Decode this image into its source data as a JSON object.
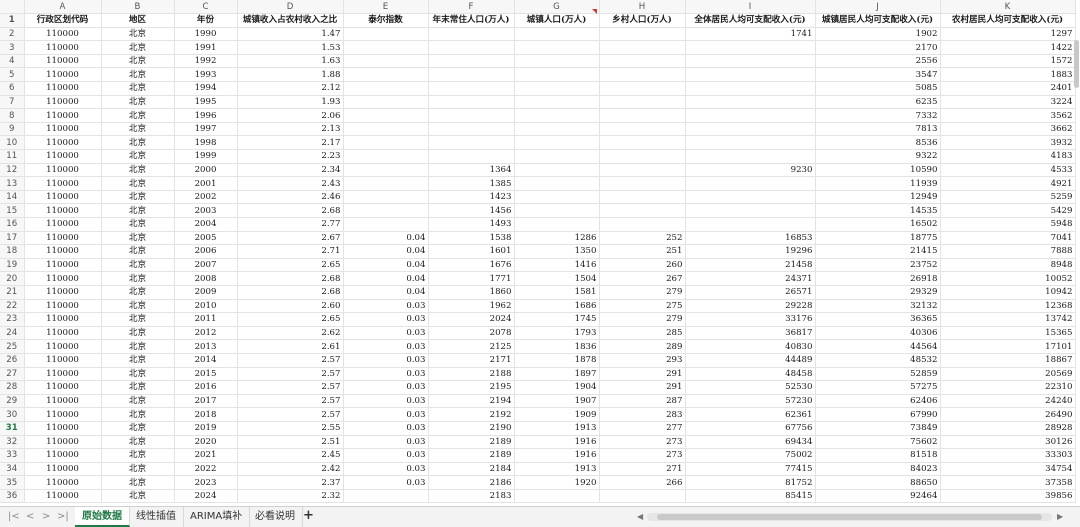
{
  "columns": [
    "A",
    "B",
    "C",
    "D",
    "E",
    "F",
    "G",
    "H",
    "I",
    "J",
    "K"
  ],
  "headers": [
    "行政区划代码",
    "地区",
    "年份",
    "城镇收入占农村收入之比",
    "泰尔指数",
    "年末常住人口(万人)",
    "城镇人口(万人)",
    "乡村人口(万人)",
    "全体居民人均可支配收入(元)",
    "城镇居民人均可支配收入(元)",
    "农村居民人均可支配收入(元)"
  ],
  "rows": [
    [
      "110000",
      "北京",
      "1990",
      "1.47",
      "",
      "",
      "",
      "",
      "1741",
      "1902",
      "1297"
    ],
    [
      "110000",
      "北京",
      "1991",
      "1.53",
      "",
      "",
      "",
      "",
      "",
      "2170",
      "1422"
    ],
    [
      "110000",
      "北京",
      "1992",
      "1.63",
      "",
      "",
      "",
      "",
      "",
      "2556",
      "1572"
    ],
    [
      "110000",
      "北京",
      "1993",
      "1.88",
      "",
      "",
      "",
      "",
      "",
      "3547",
      "1883"
    ],
    [
      "110000",
      "北京",
      "1994",
      "2.12",
      "",
      "",
      "",
      "",
      "",
      "5085",
      "2401"
    ],
    [
      "110000",
      "北京",
      "1995",
      "1.93",
      "",
      "",
      "",
      "",
      "",
      "6235",
      "3224"
    ],
    [
      "110000",
      "北京",
      "1996",
      "2.06",
      "",
      "",
      "",
      "",
      "",
      "7332",
      "3562"
    ],
    [
      "110000",
      "北京",
      "1997",
      "2.13",
      "",
      "",
      "",
      "",
      "",
      "7813",
      "3662"
    ],
    [
      "110000",
      "北京",
      "1998",
      "2.17",
      "",
      "",
      "",
      "",
      "",
      "8536",
      "3932"
    ],
    [
      "110000",
      "北京",
      "1999",
      "2.23",
      "",
      "",
      "",
      "",
      "",
      "9322",
      "4183"
    ],
    [
      "110000",
      "北京",
      "2000",
      "2.34",
      "",
      "1364",
      "",
      "",
      "9230",
      "10590",
      "4533"
    ],
    [
      "110000",
      "北京",
      "2001",
      "2.43",
      "",
      "1385",
      "",
      "",
      "",
      "11939",
      "4921"
    ],
    [
      "110000",
      "北京",
      "2002",
      "2.46",
      "",
      "1423",
      "",
      "",
      "",
      "12949",
      "5259"
    ],
    [
      "110000",
      "北京",
      "2003",
      "2.68",
      "",
      "1456",
      "",
      "",
      "",
      "14535",
      "5429"
    ],
    [
      "110000",
      "北京",
      "2004",
      "2.77",
      "",
      "1493",
      "",
      "",
      "",
      "16502",
      "5948"
    ],
    [
      "110000",
      "北京",
      "2005",
      "2.67",
      "0.04",
      "1538",
      "1286",
      "252",
      "16853",
      "18775",
      "7041"
    ],
    [
      "110000",
      "北京",
      "2006",
      "2.71",
      "0.04",
      "1601",
      "1350",
      "251",
      "19296",
      "21415",
      "7888"
    ],
    [
      "110000",
      "北京",
      "2007",
      "2.65",
      "0.04",
      "1676",
      "1416",
      "260",
      "21458",
      "23752",
      "8948"
    ],
    [
      "110000",
      "北京",
      "2008",
      "2.68",
      "0.04",
      "1771",
      "1504",
      "267",
      "24371",
      "26918",
      "10052"
    ],
    [
      "110000",
      "北京",
      "2009",
      "2.68",
      "0.04",
      "1860",
      "1581",
      "279",
      "26571",
      "29329",
      "10942"
    ],
    [
      "110000",
      "北京",
      "2010",
      "2.60",
      "0.03",
      "1962",
      "1686",
      "275",
      "29228",
      "32132",
      "12368"
    ],
    [
      "110000",
      "北京",
      "2011",
      "2.65",
      "0.03",
      "2024",
      "1745",
      "279",
      "33176",
      "36365",
      "13742"
    ],
    [
      "110000",
      "北京",
      "2012",
      "2.62",
      "0.03",
      "2078",
      "1793",
      "285",
      "36817",
      "40306",
      "15365"
    ],
    [
      "110000",
      "北京",
      "2013",
      "2.61",
      "0.03",
      "2125",
      "1836",
      "289",
      "40830",
      "44564",
      "17101"
    ],
    [
      "110000",
      "北京",
      "2014",
      "2.57",
      "0.03",
      "2171",
      "1878",
      "293",
      "44489",
      "48532",
      "18867"
    ],
    [
      "110000",
      "北京",
      "2015",
      "2.57",
      "0.03",
      "2188",
      "1897",
      "291",
      "48458",
      "52859",
      "20569"
    ],
    [
      "110000",
      "北京",
      "2016",
      "2.57",
      "0.03",
      "2195",
      "1904",
      "291",
      "52530",
      "57275",
      "22310"
    ],
    [
      "110000",
      "北京",
      "2017",
      "2.57",
      "0.03",
      "2194",
      "1907",
      "287",
      "57230",
      "62406",
      "24240"
    ],
    [
      "110000",
      "北京",
      "2018",
      "2.57",
      "0.03",
      "2192",
      "1909",
      "283",
      "62361",
      "67990",
      "26490"
    ],
    [
      "110000",
      "北京",
      "2019",
      "2.55",
      "0.03",
      "2190",
      "1913",
      "277",
      "67756",
      "73849",
      "28928"
    ],
    [
      "110000",
      "北京",
      "2020",
      "2.51",
      "0.03",
      "2189",
      "1916",
      "273",
      "69434",
      "75602",
      "30126"
    ],
    [
      "110000",
      "北京",
      "2021",
      "2.45",
      "0.03",
      "2189",
      "1916",
      "273",
      "75002",
      "81518",
      "33303"
    ],
    [
      "110000",
      "北京",
      "2022",
      "2.42",
      "0.03",
      "2184",
      "1913",
      "271",
      "77415",
      "84023",
      "34754"
    ],
    [
      "110000",
      "北京",
      "2023",
      "2.37",
      "0.03",
      "2186",
      "1920",
      "266",
      "81752",
      "88650",
      "37358"
    ],
    [
      "110000",
      "北京",
      "2024",
      "2.32",
      "",
      "2183",
      "",
      "",
      "85415",
      "92464",
      "39856"
    ]
  ],
  "active_row": "31",
  "tabs": [
    "原始数据",
    "线性插值",
    "ARIMA填补",
    "必看说明"
  ],
  "add_tab": "+",
  "nav": {
    "first": "|<",
    "prev": "<",
    "next": ">",
    "last": ">|"
  },
  "accent_color": "#1f7a45"
}
